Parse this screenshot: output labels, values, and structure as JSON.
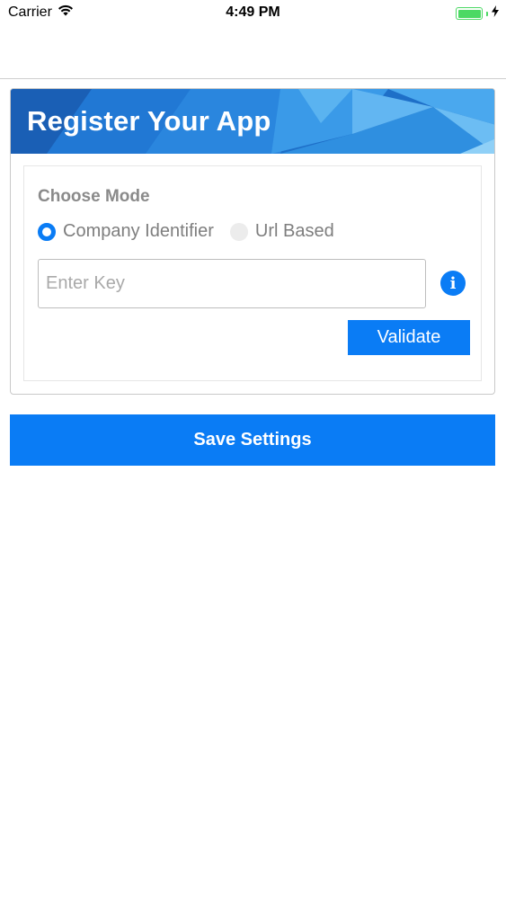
{
  "status_bar": {
    "carrier": "Carrier",
    "time": "4:49 PM",
    "icons": {
      "wifi": "wifi-icon",
      "battery": "battery-icon",
      "charging": "charging-bolt-icon"
    },
    "battery_color": "#4cd964"
  },
  "register": {
    "title": "Register Your App",
    "mode_label": "Choose Mode",
    "options": [
      {
        "label": "Company Identifier",
        "selected": true
      },
      {
        "label": "Url Based",
        "selected": false
      }
    ],
    "key_input": {
      "value": "",
      "placeholder": "Enter Key"
    },
    "info_icon": "info-icon",
    "validate_label": "Validate"
  },
  "footer": {
    "save_label": "Save Settings"
  },
  "colors": {
    "accent": "#0a7cf5",
    "header_blue": "#1e6fc8",
    "muted_text": "#8a8a8a"
  }
}
